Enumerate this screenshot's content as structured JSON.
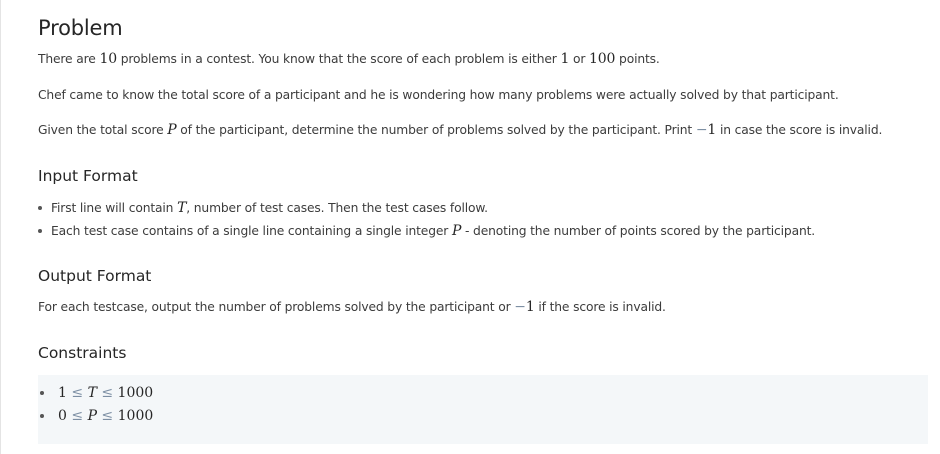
{
  "problem": {
    "title": "Problem",
    "para1": {
      "t1": "There are ",
      "n1": "10",
      "t2": " problems in a contest. You know that the score of each problem is either ",
      "n2": "1",
      "t3": " or ",
      "n3": "100",
      "t4": " points."
    },
    "para2": "Chef came to know the total score of a participant and he is wondering how many problems were actually solved by that participant.",
    "para3": {
      "t1": "Given the total score ",
      "var": "P",
      "t2": " of the participant, determine the number of problems solved by the participant. Print ",
      "neg": "−",
      "num": "1",
      "t3": " in case the score is invalid."
    }
  },
  "input_format": {
    "title": "Input Format",
    "items": [
      {
        "t1": "First line will contain ",
        "var": "T",
        "t2": ", number of test cases. Then the test cases follow."
      },
      {
        "t1": "Each test case contains of a single line containing a single integer ",
        "var": "P",
        "t2": " - denoting the number of points scored by the participant."
      }
    ]
  },
  "output_format": {
    "title": "Output Format",
    "text": {
      "t1": "For each testcase, output the number of problems solved by the participant or ",
      "neg": "−",
      "num": "1",
      "t2": " if the score is invalid."
    }
  },
  "constraints": {
    "title": "Constraints",
    "items": [
      {
        "lo": "1",
        "var": "T",
        "hi": "1000"
      },
      {
        "lo": "0",
        "var": "P",
        "hi": "1000"
      }
    ]
  }
}
